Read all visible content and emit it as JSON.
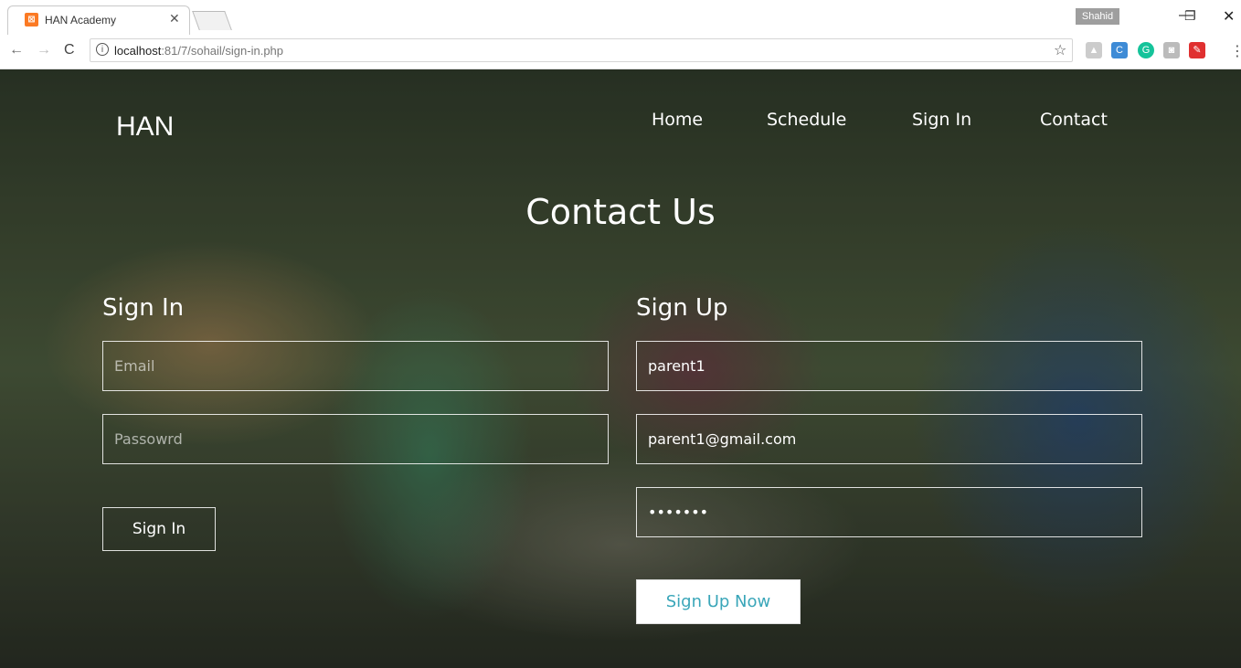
{
  "browser": {
    "tab_title": "HAN Academy",
    "tab_favicon": "han-favicon",
    "user_badge": "Shahid",
    "url_host": "localhost",
    "url_rest": ":81/7/sohail/sign-in.php"
  },
  "nav": {
    "logo": "HAN",
    "items": [
      {
        "label": "Home"
      },
      {
        "label": "Schedule"
      },
      {
        "label": "Sign In"
      },
      {
        "label": "Contact"
      }
    ]
  },
  "heading": "Contact Us",
  "sign_in": {
    "title": "Sign In",
    "email_placeholder": "Email",
    "password_placeholder": "Passowrd",
    "button": "Sign In"
  },
  "sign_up": {
    "title": "Sign Up",
    "username_value": "parent1",
    "email_value": "parent1@gmail.com",
    "password_value": "•••••••",
    "button": "Sign Up Now"
  },
  "colors": {
    "button_text": "#3aa6b9",
    "favicon": "#fb7a24"
  }
}
